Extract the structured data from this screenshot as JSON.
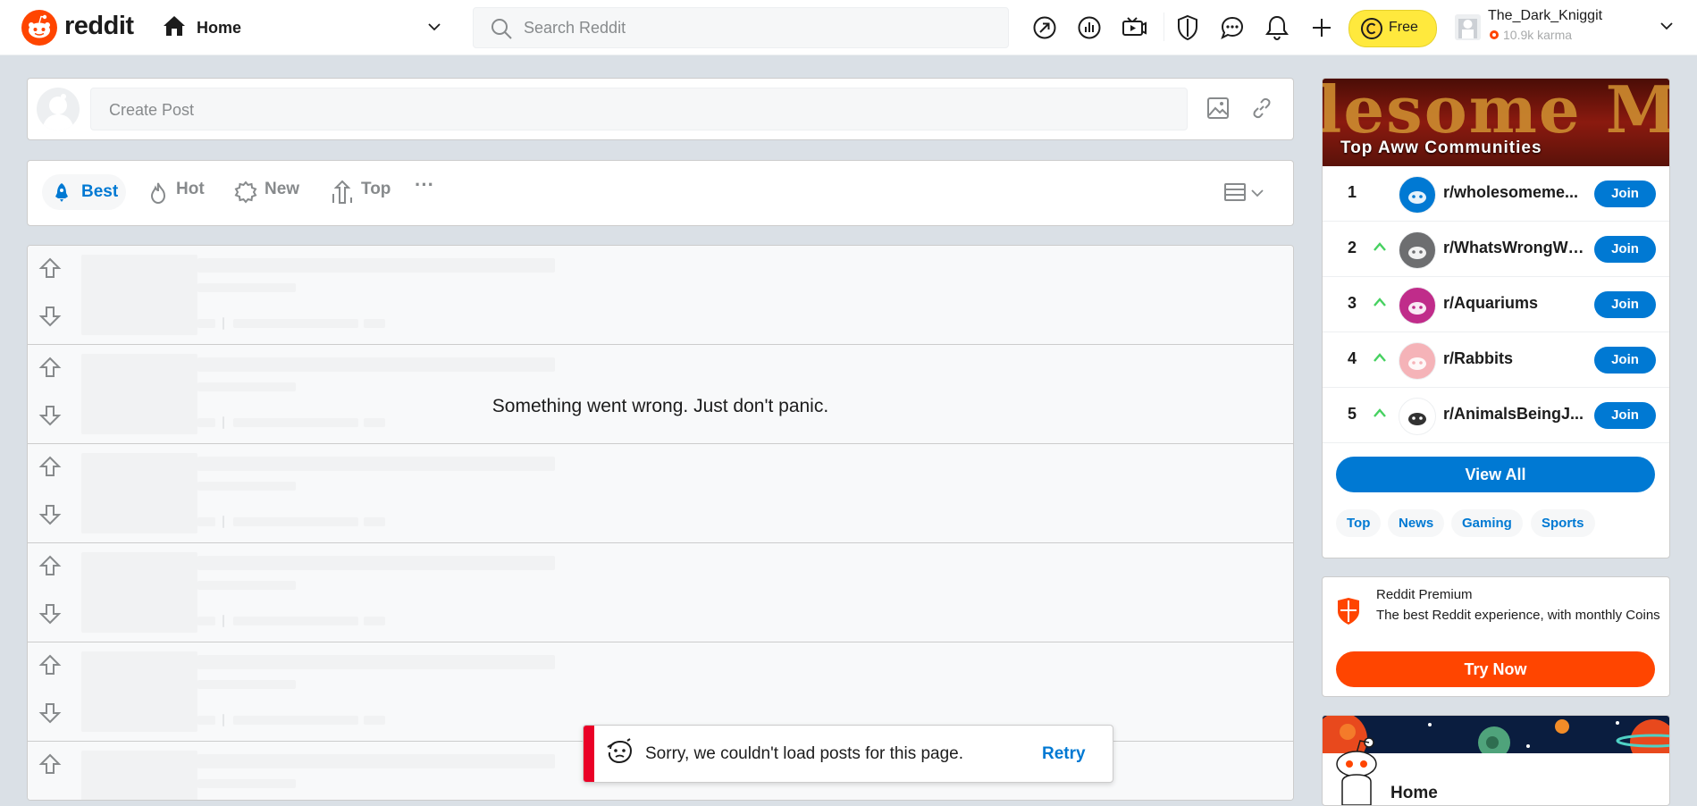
{
  "header": {
    "logo_text": "reddit",
    "nav_label": "Home",
    "search_placeholder": "Search Reddit",
    "coins_label": "Free",
    "username": "The_Dark_Kniggit",
    "karma": "10.9k karma"
  },
  "create_post": {
    "placeholder": "Create Post"
  },
  "sort": {
    "best": "Best",
    "hot": "Hot",
    "new": "New",
    "top": "Top",
    "more": "···"
  },
  "feed": {
    "error_message": "Something went wrong. Just don't panic."
  },
  "toast": {
    "message": "Sorry, we couldn't load posts for this page.",
    "retry_label": "Retry"
  },
  "communities": {
    "title": "Top  Aww  Communities",
    "banner_art_text": "lesome Me",
    "items": [
      {
        "rank": "1",
        "name": "r/wholesomeme...",
        "join": "Join",
        "trend": false
      },
      {
        "rank": "2",
        "name": "r/WhatsWrongWi...",
        "join": "Join",
        "trend": true
      },
      {
        "rank": "3",
        "name": "r/Aquariums",
        "join": "Join",
        "trend": true
      },
      {
        "rank": "4",
        "name": "r/Rabbits",
        "join": "Join",
        "trend": true
      },
      {
        "rank": "5",
        "name": "r/AnimalsBeingJ...",
        "join": "Join",
        "trend": true
      }
    ],
    "view_all": "View All",
    "tags": [
      "Top",
      "News",
      "Gaming",
      "Sports"
    ]
  },
  "premium": {
    "title": "Reddit Premium",
    "description": "The best Reddit experience, with monthly Coins",
    "button": "Try Now"
  },
  "home_card": {
    "title": "Home"
  },
  "colors": {
    "brand": "#ff4500",
    "accent_blue": "#0079d3",
    "error_red": "#ea0027",
    "coins_yellow": "#ffe93d",
    "trend_green": "#46d160"
  }
}
